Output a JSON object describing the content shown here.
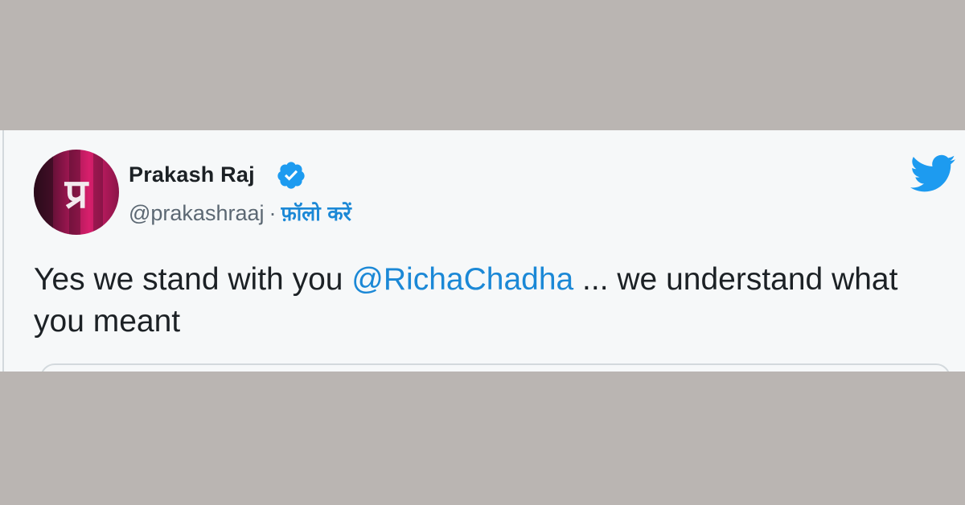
{
  "colors": {
    "background_band": "#bab5b2",
    "card_background": "#f6f8f9",
    "card_border": "#d3d9dd",
    "text_primary": "#1c2125",
    "text_secondary": "#5c6873",
    "link": "#1b88d6",
    "verified": "#1d9bf0",
    "twitter_blue": "#1d9bf0",
    "avatar_dark": "#2a0b1b",
    "avatar_mid": "#8a1448",
    "avatar_bright": "#d71f6c"
  },
  "tweet": {
    "author": {
      "display_name": "Prakash Raj",
      "handle": "@prakashraaj",
      "separator": "·",
      "follow_label": "फ़ॉलो करें",
      "avatar_glyph": "प्र",
      "verified_icon": "verified-badge-icon"
    },
    "platform_icon": "twitter-bird-icon",
    "text_before_mention": "Yes we stand with you ",
    "mention": "@RichaChadha",
    "text_after_mention": " ... we understand what you meant"
  }
}
